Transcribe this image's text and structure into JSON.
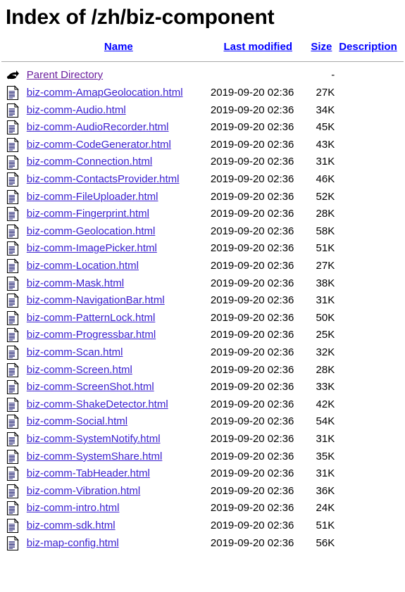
{
  "page": {
    "title": "Index of /zh/biz-component",
    "directory": "/zh/biz-component"
  },
  "columns": {
    "icon_label": "",
    "name": "Name",
    "last_modified": "Last modified",
    "size": "Size",
    "description": "Description"
  },
  "parent": {
    "icon": "back-arrow-icon",
    "label": "Parent Directory",
    "last_modified": "",
    "size": "-",
    "description": ""
  },
  "rows": [
    {
      "icon": "text-file-icon",
      "name": "biz-comm-AmapGeolocation.html",
      "modified": "2019-09-20 02:36",
      "size": "27K",
      "description": ""
    },
    {
      "icon": "text-file-icon",
      "name": "biz-comm-Audio.html",
      "modified": "2019-09-20 02:36",
      "size": "34K",
      "description": ""
    },
    {
      "icon": "text-file-icon",
      "name": "biz-comm-AudioRecorder.html",
      "modified": "2019-09-20 02:36",
      "size": "45K",
      "description": ""
    },
    {
      "icon": "text-file-icon",
      "name": "biz-comm-CodeGenerator.html",
      "modified": "2019-09-20 02:36",
      "size": "43K",
      "description": ""
    },
    {
      "icon": "text-file-icon",
      "name": "biz-comm-Connection.html",
      "modified": "2019-09-20 02:36",
      "size": "31K",
      "description": ""
    },
    {
      "icon": "text-file-icon",
      "name": "biz-comm-ContactsProvider.html",
      "modified": "2019-09-20 02:36",
      "size": "46K",
      "description": ""
    },
    {
      "icon": "text-file-icon",
      "name": "biz-comm-FileUploader.html",
      "modified": "2019-09-20 02:36",
      "size": "52K",
      "description": ""
    },
    {
      "icon": "text-file-icon",
      "name": "biz-comm-Fingerprint.html",
      "modified": "2019-09-20 02:36",
      "size": "28K",
      "description": ""
    },
    {
      "icon": "text-file-icon",
      "name": "biz-comm-Geolocation.html",
      "modified": "2019-09-20 02:36",
      "size": "58K",
      "description": ""
    },
    {
      "icon": "text-file-icon",
      "name": "biz-comm-ImagePicker.html",
      "modified": "2019-09-20 02:36",
      "size": "51K",
      "description": ""
    },
    {
      "icon": "text-file-icon",
      "name": "biz-comm-Location.html",
      "modified": "2019-09-20 02:36",
      "size": "27K",
      "description": ""
    },
    {
      "icon": "text-file-icon",
      "name": "biz-comm-Mask.html",
      "modified": "2019-09-20 02:36",
      "size": "38K",
      "description": ""
    },
    {
      "icon": "text-file-icon",
      "name": "biz-comm-NavigationBar.html",
      "modified": "2019-09-20 02:36",
      "size": "31K",
      "description": ""
    },
    {
      "icon": "text-file-icon",
      "name": "biz-comm-PatternLock.html",
      "modified": "2019-09-20 02:36",
      "size": "50K",
      "description": ""
    },
    {
      "icon": "text-file-icon",
      "name": "biz-comm-Progressbar.html",
      "modified": "2019-09-20 02:36",
      "size": "25K",
      "description": ""
    },
    {
      "icon": "text-file-icon",
      "name": "biz-comm-Scan.html",
      "modified": "2019-09-20 02:36",
      "size": "32K",
      "description": ""
    },
    {
      "icon": "text-file-icon",
      "name": "biz-comm-Screen.html",
      "modified": "2019-09-20 02:36",
      "size": "28K",
      "description": ""
    },
    {
      "icon": "text-file-icon",
      "name": "biz-comm-ScreenShot.html",
      "modified": "2019-09-20 02:36",
      "size": "33K",
      "description": ""
    },
    {
      "icon": "text-file-icon",
      "name": "biz-comm-ShakeDetector.html",
      "modified": "2019-09-20 02:36",
      "size": "42K",
      "description": ""
    },
    {
      "icon": "text-file-icon",
      "name": "biz-comm-Social.html",
      "modified": "2019-09-20 02:36",
      "size": "54K",
      "description": ""
    },
    {
      "icon": "text-file-icon",
      "name": "biz-comm-SystemNotify.html",
      "modified": "2019-09-20 02:36",
      "size": "31K",
      "description": ""
    },
    {
      "icon": "text-file-icon",
      "name": "biz-comm-SystemShare.html",
      "modified": "2019-09-20 02:36",
      "size": "35K",
      "description": ""
    },
    {
      "icon": "text-file-icon",
      "name": "biz-comm-TabHeader.html",
      "modified": "2019-09-20 02:36",
      "size": "31K",
      "description": ""
    },
    {
      "icon": "text-file-icon",
      "name": "biz-comm-Vibration.html",
      "modified": "2019-09-20 02:36",
      "size": "36K",
      "description": ""
    },
    {
      "icon": "text-file-icon",
      "name": "biz-comm-intro.html",
      "modified": "2019-09-20 02:36",
      "size": "24K",
      "description": ""
    },
    {
      "icon": "text-file-icon",
      "name": "biz-comm-sdk.html",
      "modified": "2019-09-20 02:36",
      "size": "51K",
      "description": ""
    },
    {
      "icon": "text-file-icon",
      "name": "biz-map-config.html",
      "modified": "2019-09-20 02:36",
      "size": "56K",
      "description": ""
    }
  ],
  "colors": {
    "link": "#3a1fd0",
    "visited_link": "#6b1f9e",
    "header_link": "#0000ff",
    "text": "#000000",
    "rule": "#a9a9a9",
    "background": "#ffffff"
  }
}
